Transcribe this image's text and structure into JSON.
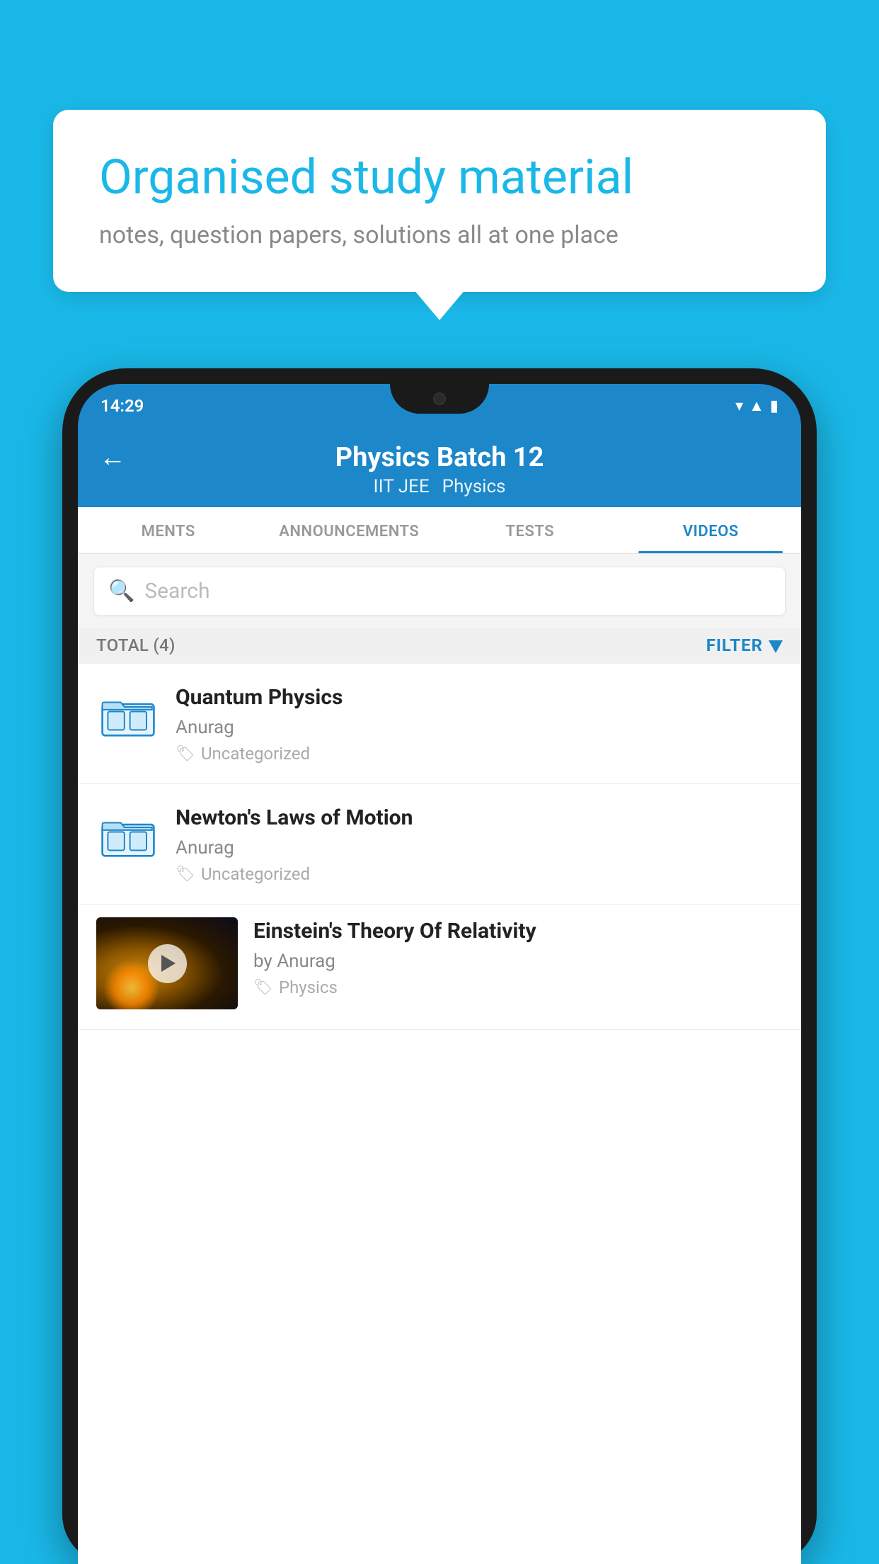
{
  "background": {
    "color": "#1ab8e8"
  },
  "speech_bubble": {
    "title": "Organised study material",
    "subtitle": "notes, question papers, solutions all at one place"
  },
  "phone": {
    "status_bar": {
      "time": "14:29"
    },
    "header": {
      "title": "Physics Batch 12",
      "subtitle_parts": [
        "IIT JEE",
        "Physics"
      ],
      "back_label": "←"
    },
    "tabs": [
      {
        "label": "MENTS",
        "active": false
      },
      {
        "label": "ANNOUNCEMENTS",
        "active": false
      },
      {
        "label": "TESTS",
        "active": false
      },
      {
        "label": "VIDEOS",
        "active": true
      }
    ],
    "search": {
      "placeholder": "Search"
    },
    "filter_row": {
      "total_label": "TOTAL (4)",
      "filter_label": "FILTER"
    },
    "videos": [
      {
        "id": "quantum",
        "title": "Quantum Physics",
        "author": "Anurag",
        "tag": "Uncategorized",
        "type": "folder"
      },
      {
        "id": "newton",
        "title": "Newton's Laws of Motion",
        "author": "Anurag",
        "tag": "Uncategorized",
        "type": "folder"
      },
      {
        "id": "einstein",
        "title": "Einstein's Theory Of Relativity",
        "author": "by Anurag",
        "tag": "Physics",
        "type": "video"
      }
    ]
  }
}
